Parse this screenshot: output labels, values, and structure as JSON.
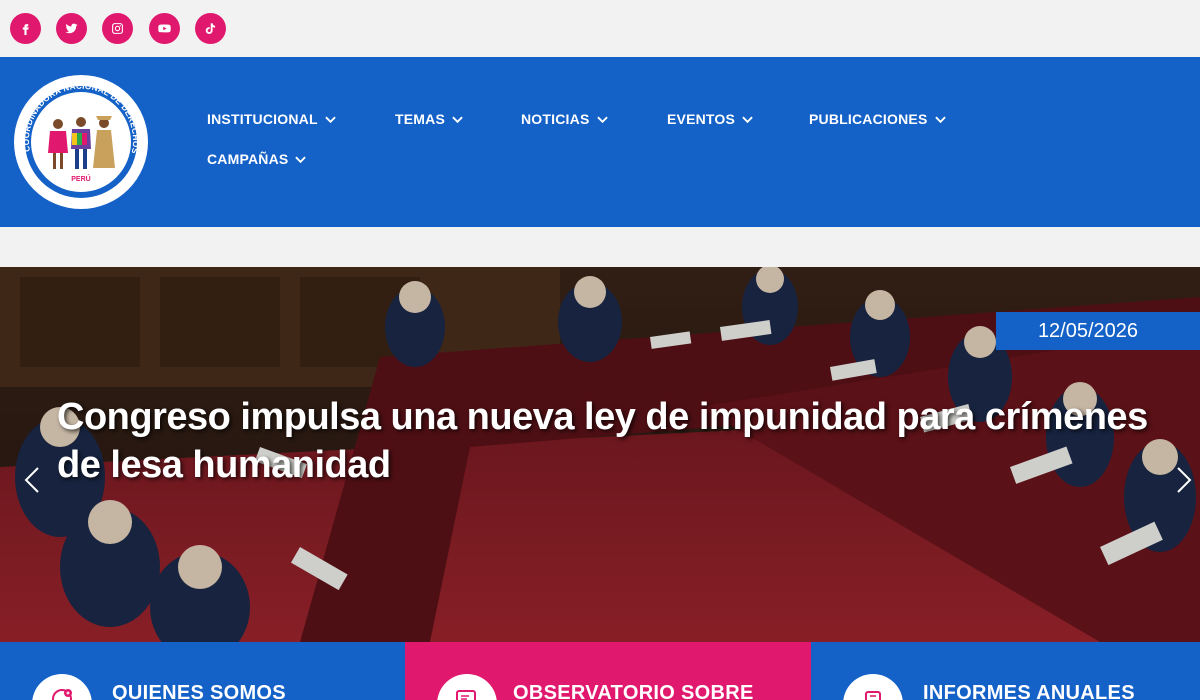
{
  "social": [
    {
      "name": "facebook-icon"
    },
    {
      "name": "twitter-icon"
    },
    {
      "name": "instagram-icon"
    },
    {
      "name": "youtube-icon"
    },
    {
      "name": "tiktok-icon"
    }
  ],
  "colors": {
    "brand_blue": "#1461c7",
    "brand_pink": "#e0196e",
    "background": "#f2f2f2"
  },
  "logo": {
    "ring_text": "COORDINADORA NACIONAL DE DERECHOS HUMANOS",
    "country": "PERÚ"
  },
  "nav": {
    "items": [
      {
        "label": "INSTITUCIONAL"
      },
      {
        "label": "TEMAS"
      },
      {
        "label": "NOTICIAS"
      },
      {
        "label": "EVENTOS"
      },
      {
        "label": "PUBLICACIONES"
      },
      {
        "label": "CAMPAÑAS"
      }
    ]
  },
  "slider": {
    "date": "12/05/2026",
    "headline": "Congreso impulsa una nueva ley de impunidad para crímenes de lesa humanidad"
  },
  "cards": [
    {
      "title": "QUIENES SOMOS",
      "icon": "handshake-icon",
      "color": "#1461c7"
    },
    {
      "title": "OBSERVATORIO SOBRE",
      "icon": "monitor-icon",
      "color": "#e0196e"
    },
    {
      "title": "INFORMES ANUALES",
      "icon": "book-icon",
      "color": "#1461c7"
    }
  ]
}
